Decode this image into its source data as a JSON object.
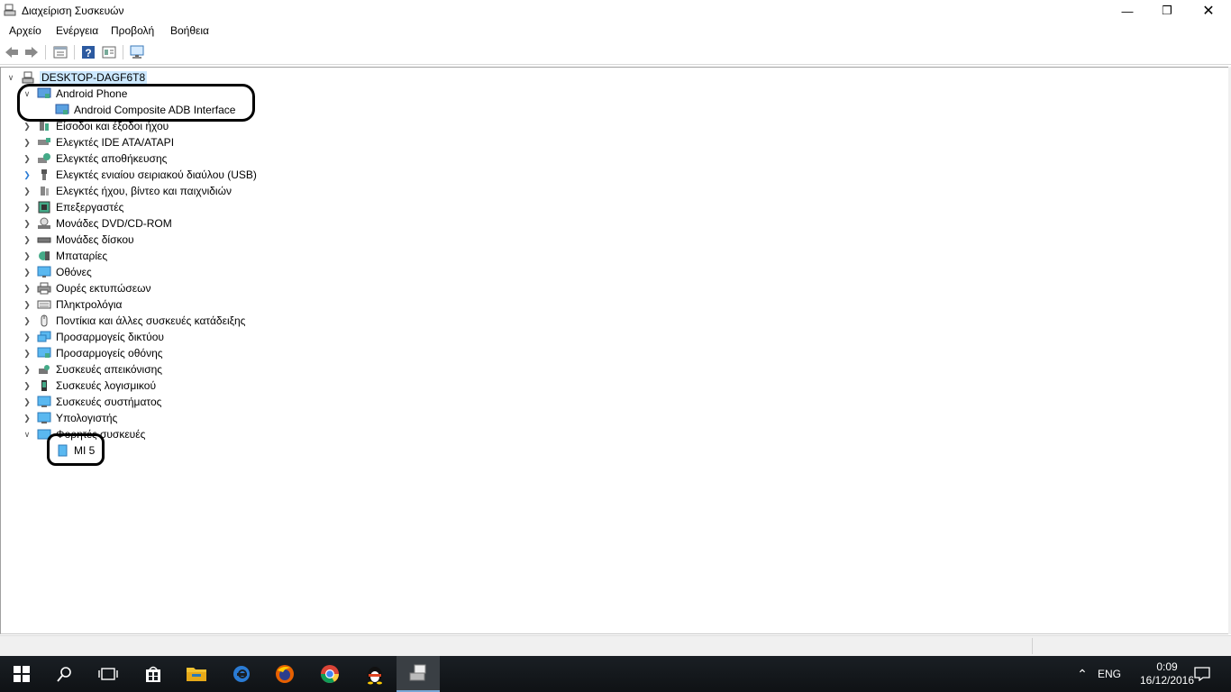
{
  "window": {
    "title": "Διαχείριση Συσκευών",
    "minimize_icon": "minimize-icon",
    "maximize_icon": "restore-icon",
    "close_icon": "close-icon"
  },
  "menu": {
    "items": [
      "Αρχείο",
      "Ενέργεια",
      "Προβολή",
      "Βοήθεια"
    ]
  },
  "toolbar": {
    "icons": [
      "back-arrow-icon",
      "forward-arrow-icon",
      "properties-icon",
      "help-icon",
      "view-icon",
      "monitor-icon"
    ]
  },
  "tree": {
    "root": "DESKTOP-DAGF6T8",
    "nodes": [
      {
        "label": "Android Phone",
        "expanded": true
      },
      {
        "label": "Android Composite ADB Interface",
        "child": true
      },
      {
        "label": "Είσοδοι και έξοδοι ήχου"
      },
      {
        "label": "Ελεγκτές IDE ATA/ATAPI"
      },
      {
        "label": "Ελεγκτές αποθήκευσης"
      },
      {
        "label": "Ελεγκτές ενιαίου σειριακού διαύλου (USB)"
      },
      {
        "label": "Ελεγκτές ήχου, βίντεο και παιχνιδιών"
      },
      {
        "label": "Επεξεργαστές"
      },
      {
        "label": "Μονάδες DVD/CD-ROM"
      },
      {
        "label": "Μονάδες δίσκου"
      },
      {
        "label": "Μπαταρίες"
      },
      {
        "label": "Οθόνες"
      },
      {
        "label": "Ουρές εκτυπώσεων"
      },
      {
        "label": "Πληκτρολόγια"
      },
      {
        "label": "Ποντίκια και άλλες συσκευές κατάδειξης"
      },
      {
        "label": "Προσαρμογείς δικτύου"
      },
      {
        "label": "Προσαρμογείς οθόνης"
      },
      {
        "label": "Συσκευές απεικόνισης"
      },
      {
        "label": "Συσκευές λογισμικού"
      },
      {
        "label": "Συσκευές συστήματος"
      },
      {
        "label": "Υπολογιστής"
      },
      {
        "label": "Φορητές συσκευές",
        "expanded": true
      },
      {
        "label": "MI 5",
        "child": true
      }
    ]
  },
  "taskbar": {
    "language": "ENG",
    "time": "0:09",
    "date": "16/12/2016"
  }
}
